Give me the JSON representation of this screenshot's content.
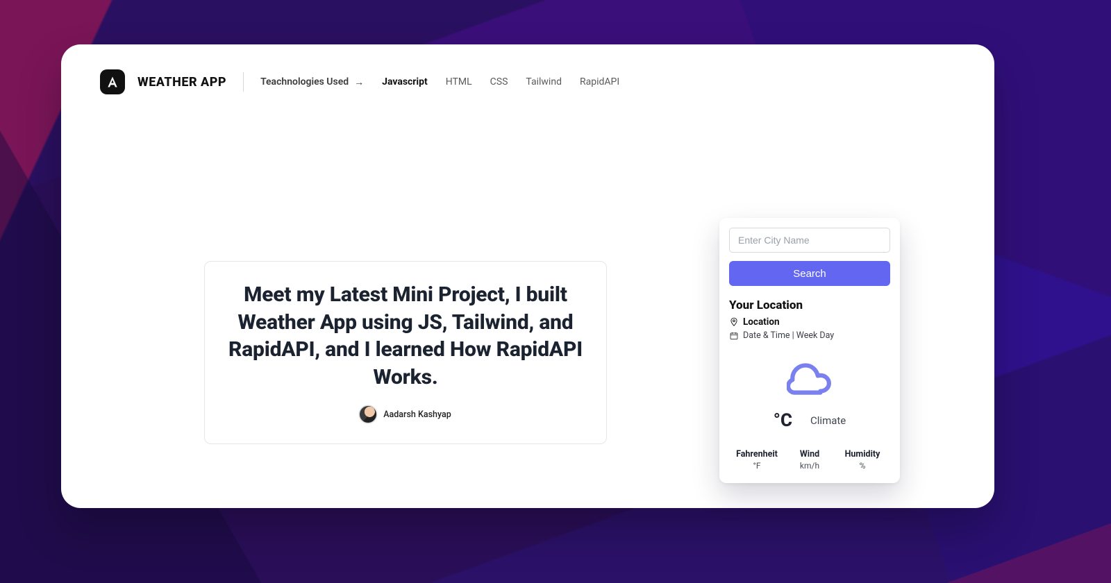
{
  "header": {
    "brand": "WEATHER APP",
    "tech_label": "Teachnologies Used",
    "tech_items": [
      "Javascript",
      "HTML",
      "CSS",
      "Tailwind",
      "RapidAPI"
    ]
  },
  "hero": {
    "title": "Meet my Latest Mini Project, I built Weather App using JS, Tailwind, and RapidAPI, and I learned How RapidAPI Works.",
    "author": "Aadarsh Kashyap"
  },
  "widget": {
    "input_placeholder": "Enter City Name",
    "search_label": "Search",
    "your_location_label": "Your Location",
    "location_value": "Location",
    "datetime_value": "Date & Time | Week Day",
    "temp_unit": "°C",
    "climate_label": "Climate",
    "stats": {
      "fahrenheit": {
        "label": "Fahrenheit",
        "value": "°F"
      },
      "wind": {
        "label": "Wind",
        "value": "km/h"
      },
      "humidity": {
        "label": "Humidity",
        "value": "%"
      }
    }
  },
  "colors": {
    "accent": "#6366f1"
  }
}
